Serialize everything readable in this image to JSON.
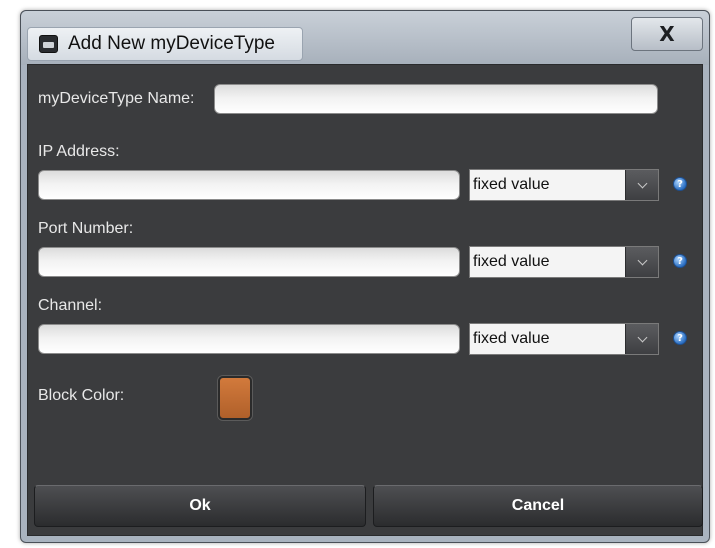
{
  "window": {
    "title": "Add New myDeviceType",
    "close_glyph": "X",
    "app_icon": "device-type-icon"
  },
  "form": {
    "name_label": "myDeviceType Name:",
    "name_value": "",
    "fields": [
      {
        "label": "IP Address:",
        "value": "",
        "mode": "fixed value"
      },
      {
        "label": "Port Number:",
        "value": "",
        "mode": "fixed value"
      },
      {
        "label": "Channel:",
        "value": "",
        "mode": "fixed value"
      }
    ],
    "help_glyph": "?",
    "block_color_label": "Block Color:",
    "block_color": "#d27a3c"
  },
  "buttons": {
    "ok": "Ok",
    "cancel": "Cancel"
  }
}
